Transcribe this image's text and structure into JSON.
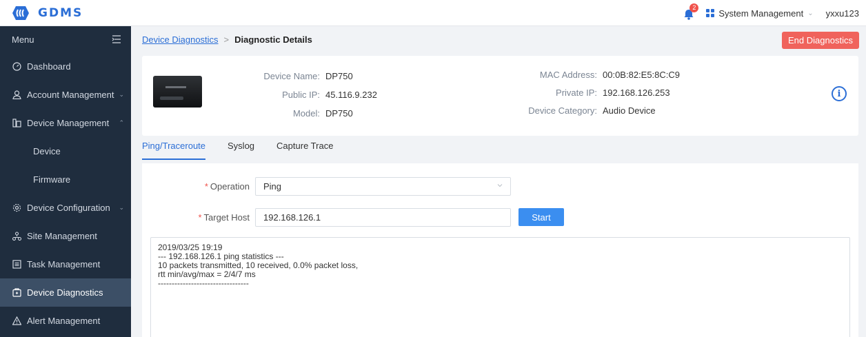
{
  "app": {
    "brand": "GDMS",
    "notification_count": "2",
    "system_menu_label": "System Management",
    "username": "yxxu123"
  },
  "sidebar": {
    "menu_label": "Menu",
    "items": [
      {
        "label": "Dashboard",
        "icon": "dashboard-icon"
      },
      {
        "label": "Account Management",
        "icon": "user-icon"
      },
      {
        "label": "Device Management",
        "icon": "device-icon"
      },
      {
        "label": "Device"
      },
      {
        "label": "Firmware"
      },
      {
        "label": "Device Configuration",
        "icon": "gear-icon"
      },
      {
        "label": "Site Management",
        "icon": "site-icon"
      },
      {
        "label": "Task Management",
        "icon": "task-icon"
      },
      {
        "label": "Device Diagnostics",
        "icon": "diagnostics-icon"
      },
      {
        "label": "Alert Management",
        "icon": "alert-icon"
      }
    ]
  },
  "breadcrumb": {
    "parent": "Device Diagnostics",
    "separator": ">",
    "current": "Diagnostic Details"
  },
  "actions": {
    "end_label": "End Diagnostics"
  },
  "device": {
    "name_label": "Device Name:",
    "name": "DP750",
    "public_ip_label": "Public IP:",
    "public_ip": "45.116.9.232",
    "model_label": "Model:",
    "model": "DP750",
    "mac_label": "MAC Address:",
    "mac": "00:0B:82:E5:8C:C9",
    "private_ip_label": "Private IP:",
    "private_ip": "192.168.126.253",
    "category_label": "Device Category:",
    "category": "Audio Device"
  },
  "tabs": [
    "Ping/Traceroute",
    "Syslog",
    "Capture Trace"
  ],
  "form": {
    "operation_label": "Operation",
    "operation_value": "Ping",
    "target_label": "Target Host",
    "target_value": "192.168.126.1",
    "start_label": "Start",
    "required_mark": "*"
  },
  "output": {
    "lines": [
      "2019/03/25 19:19",
      "--- 192.168.126.1 ping statistics ---",
      "10 packets transmitted, 10 received, 0.0% packet loss,",
      "rtt min/avg/max = 2/4/7 ms",
      "---------------------------------"
    ]
  },
  "colors": {
    "accent": "#2b6ed6",
    "danger": "#f0635c",
    "sidebar_bg": "#1f2d3e",
    "sidebar_active": "#3c4f66"
  }
}
